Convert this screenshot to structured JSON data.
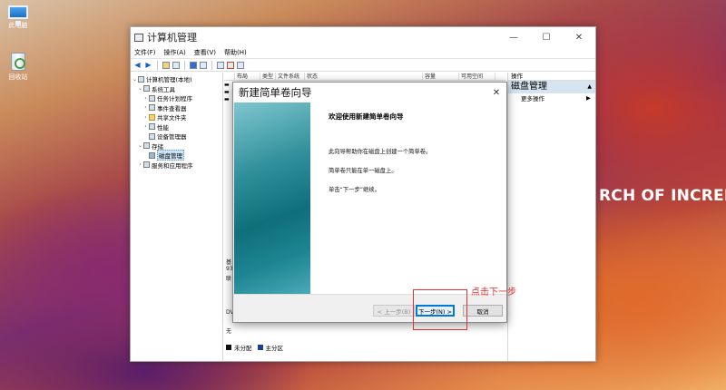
{
  "desktop": {
    "icons": [
      {
        "label": "此电脑",
        "icon": "computer-icon"
      },
      {
        "label": "回收站",
        "icon": "recycle-bin-icon"
      }
    ],
    "wallpaper_text": "RCH OF INCREDIBLE"
  },
  "window": {
    "title": "计算机管理",
    "controls": {
      "minimize": "—",
      "maximize": "☐",
      "close": "✕"
    },
    "menu": [
      "文件(F)",
      "操作(A)",
      "查看(V)",
      "帮助(H)"
    ],
    "tree": [
      {
        "label": "计算机管理(本地)",
        "twisty": "⌄",
        "indent": 0,
        "icon": "computer-management-icon"
      },
      {
        "label": "系统工具",
        "twisty": "⌄",
        "indent": 1,
        "icon": "system-tools-icon"
      },
      {
        "label": "任务计划程序",
        "twisty": "›",
        "indent": 2,
        "icon": "task-scheduler-icon"
      },
      {
        "label": "事件查看器",
        "twisty": "›",
        "indent": 2,
        "icon": "event-viewer-icon"
      },
      {
        "label": "共享文件夹",
        "twisty": "›",
        "indent": 2,
        "icon": "shared-folders-icon"
      },
      {
        "label": "性能",
        "twisty": "›",
        "indent": 2,
        "icon": "performance-icon"
      },
      {
        "label": "设备管理器",
        "twisty": "",
        "indent": 2,
        "icon": "device-manager-icon"
      },
      {
        "label": "存储",
        "twisty": "⌄",
        "indent": 1,
        "icon": "storage-icon"
      },
      {
        "label": "磁盘管理",
        "twisty": "",
        "indent": 2,
        "icon": "disk-management-icon",
        "selected": true
      },
      {
        "label": "服务和应用程序",
        "twisty": "›",
        "indent": 1,
        "icon": "services-apps-icon"
      }
    ],
    "columns": [
      "",
      "布局",
      "类型",
      "文件系统",
      "状态",
      "容量",
      "可用空间"
    ],
    "disk_fragments": [
      "基",
      "93",
      "联",
      "DV",
      "无"
    ],
    "legend": [
      {
        "label": "未分配",
        "color": "#111111"
      },
      {
        "label": "主分区",
        "color": "#1b3f9c"
      }
    ],
    "actions": {
      "header": "操作",
      "title": "磁盘管理",
      "caret": "▲",
      "more": "更多操作",
      "more_arrow": "▶"
    }
  },
  "wizard": {
    "title": "新建简单卷向导",
    "close": "✕",
    "heading": "欢迎使用新建简单卷向导",
    "paragraphs": [
      "此向导帮助你在磁盘上创建一个简单卷。",
      "简单卷只能在单一磁盘上。",
      "单击“下一步”继续。"
    ],
    "buttons": {
      "back": "< 上一步(B)",
      "next": "下一步(N) >",
      "cancel": "取消"
    }
  },
  "annotation": {
    "text": "点击下一步",
    "color": "#e03030"
  }
}
